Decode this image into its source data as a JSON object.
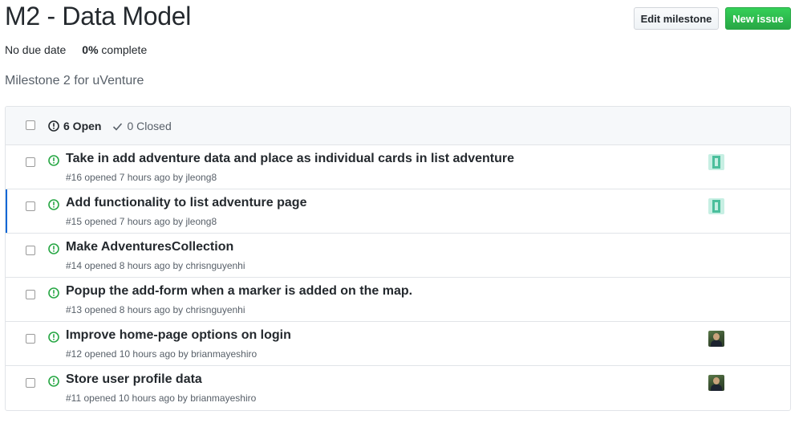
{
  "milestone": {
    "title": "M2 - Data Model",
    "due": "No due date",
    "percent": "0%",
    "percent_suffix": " complete",
    "description": "Milestone 2 for uVenture"
  },
  "buttons": {
    "edit": "Edit milestone",
    "new_issue": "New issue"
  },
  "filters": {
    "open": "6 Open",
    "closed": "0 Closed"
  },
  "issues": [
    {
      "title": "Take in add adventure data and place as individual cards in list adventure",
      "meta": "#16 opened 7 hours ago by jleong8",
      "avatar": "identicon-green"
    },
    {
      "title": "Add functionality to list adventure page",
      "meta": "#15 opened 7 hours ago by jleong8",
      "avatar": "identicon-green"
    },
    {
      "title": "Make AdventuresCollection",
      "meta": "#14 opened 8 hours ago by chrisnguyenhi",
      "avatar": ""
    },
    {
      "title": "Popup the add-form when a marker is added on the map.",
      "meta": "#13 opened 8 hours ago by chrisnguyenhi",
      "avatar": ""
    },
    {
      "title": "Improve home-page options on login",
      "meta": "#12 opened 10 hours ago by brianmayeshiro",
      "avatar": "photo"
    },
    {
      "title": "Store user profile data",
      "meta": "#11 opened 10 hours ago by brianmayeshiro",
      "avatar": "photo"
    }
  ],
  "colors": {
    "open_icon": "#28a745",
    "primary_button": "#28a745",
    "active_row_marker": "#0366d6"
  }
}
